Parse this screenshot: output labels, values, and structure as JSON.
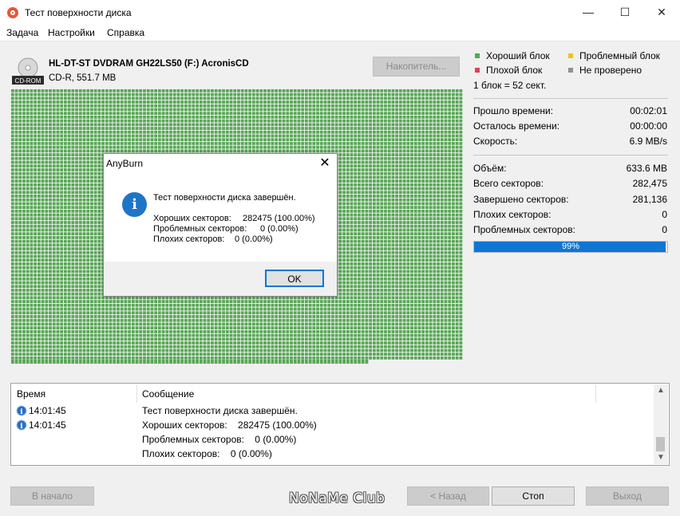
{
  "window": {
    "title": "Тест поверхности диска",
    "min": "—",
    "max": "☐",
    "close": "✕"
  },
  "menu": [
    "Задача",
    "Настройки",
    "Справка"
  ],
  "drive": {
    "badge": "CD-ROM",
    "name": "HL-DT-ST DVDRAM GH22LS50 (F:) AcronisCD",
    "info": "CD-R, 551.7 MB",
    "button": "Накопитель..."
  },
  "legend": {
    "good": "Хороший блок",
    "problem": "Проблемный блок",
    "bad": "Плохой блок",
    "unchecked": "Не проверено",
    "block_size": "1 блок = 52 сект.",
    "colors": {
      "good": "#4caf50",
      "problem": "#f0c020",
      "bad": "#e04050",
      "unchecked": "#909090"
    }
  },
  "stats": {
    "elapsed_label": "Прошло времени:",
    "elapsed": "00:02:01",
    "remaining_label": "Осталось времени:",
    "remaining": "00:00:00",
    "speed_label": "Скорость:",
    "speed": "6.9 MB/s",
    "volume_label": "Объём:",
    "volume": "633.6 MB",
    "total_label": "Всего секторов:",
    "total": "282,475",
    "done_label": "Завершено секторов:",
    "done": "281,136",
    "bad_label": "Плохих секторов:",
    "bad": "0",
    "problem_label": "Проблемных секторов:",
    "problem": "0",
    "progress_text": "99%",
    "progress_value": 0.99
  },
  "dialog": {
    "title": "AnyBurn",
    "message": "Тест поверхности диска завершён.",
    "good_label": "Хороших секторов:",
    "good_value": "282475 (100.00%)",
    "problem_label": "Проблемных секторов:",
    "problem_value": "0 (0.00%)",
    "bad_label": "Плохих секторов:",
    "bad_value": "0 (0.00%)",
    "ok": "OK"
  },
  "log": {
    "col_time": "Время",
    "col_message": "Сообщение",
    "rows": [
      {
        "time": "14:01:45",
        "message": "Тест поверхности диска завершён."
      },
      {
        "time": "14:01:45",
        "message": "Хороших секторов:    282475 (100.00%)"
      },
      {
        "time": "",
        "message": "Проблемных секторов:    0 (0.00%)"
      },
      {
        "time": "",
        "message": "Плохих секторов:    0 (0.00%)"
      }
    ]
  },
  "buttons": {
    "start": "В начало",
    "back": "< Назад",
    "stop": "Стоп",
    "next": "Выход"
  },
  "watermark": "NoNaMe Club"
}
